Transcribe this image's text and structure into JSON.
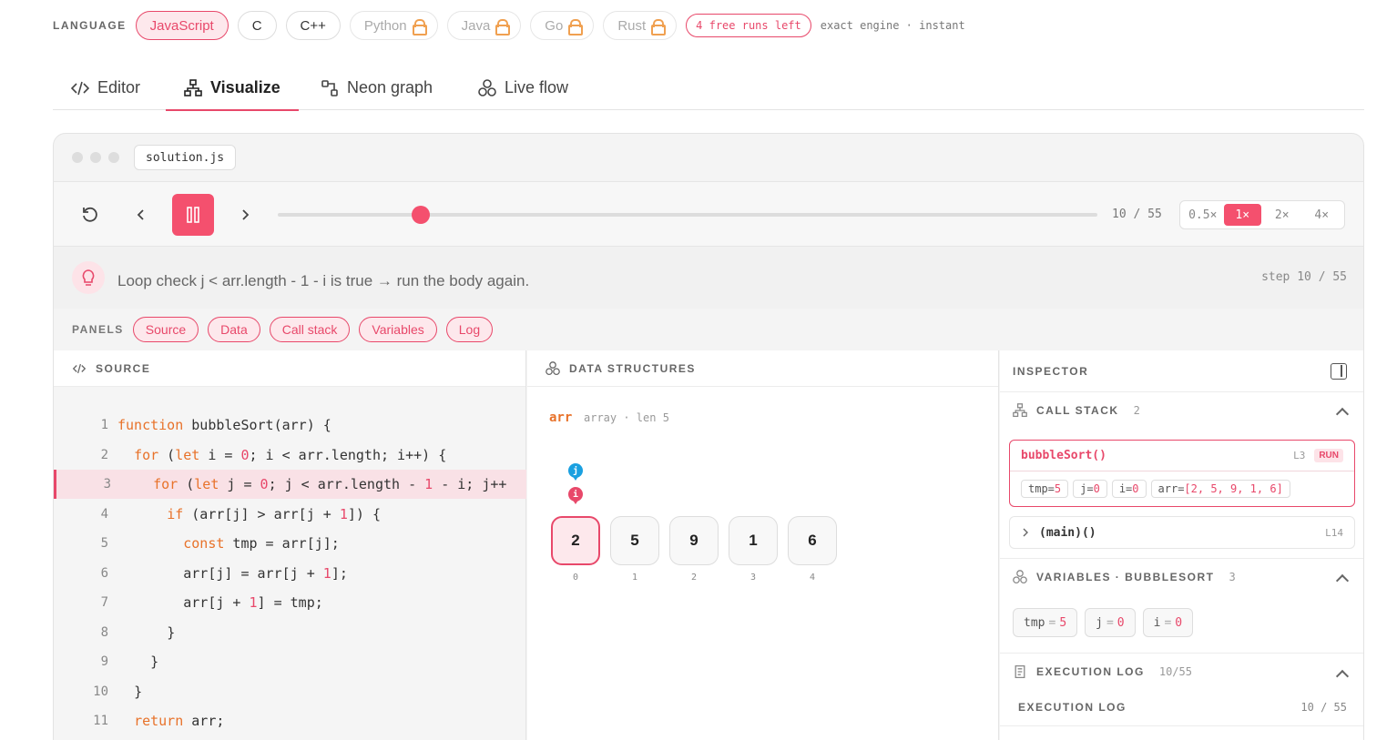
{
  "language_bar": {
    "label": "LANGUAGE",
    "languages": [
      {
        "name": "JavaScript",
        "state": "active"
      },
      {
        "name": "C",
        "state": "available"
      },
      {
        "name": "C++",
        "state": "available"
      },
      {
        "name": "Python",
        "state": "locked"
      },
      {
        "name": "Java",
        "state": "locked"
      },
      {
        "name": "Go",
        "state": "locked"
      },
      {
        "name": "Rust",
        "state": "locked"
      }
    ],
    "free_runs": "4 free runs left",
    "engine_note": "exact engine · instant"
  },
  "tabs": [
    {
      "label": "Editor",
      "icon": "code-icon"
    },
    {
      "label": "Visualize",
      "icon": "sitemap-icon",
      "active": true
    },
    {
      "label": "Neon graph",
      "icon": "graph-icon"
    },
    {
      "label": "Live flow",
      "icon": "hexagons-icon"
    }
  ],
  "window": {
    "filename": "solution.js"
  },
  "player": {
    "step_label": "10 / 55",
    "progress": 0.174,
    "speeds": [
      "0.5×",
      "1×",
      "2×",
      "4×"
    ],
    "active_speed": "1×"
  },
  "hint": {
    "text": "Loop check j < arr.length - 1 - i is true → run the body again.",
    "step": "step 10 / 55"
  },
  "panels": {
    "label": "PANELS",
    "items": [
      "Source",
      "Data",
      "Call stack",
      "Variables",
      "Log"
    ]
  },
  "source": {
    "title": "SOURCE",
    "highlighted_line": 3,
    "lines": [
      {
        "n": "1",
        "indent": "",
        "tokens": [
          {
            "t": "function",
            "c": "kw"
          },
          {
            "t": " bubbleSort(arr) {",
            "c": ""
          }
        ]
      },
      {
        "n": "2",
        "indent": "  ",
        "tokens": [
          {
            "t": "for",
            "c": "kw"
          },
          {
            "t": " (",
            "c": ""
          },
          {
            "t": "let",
            "c": "kw"
          },
          {
            "t": " i = ",
            "c": ""
          },
          {
            "t": "0",
            "c": "num"
          },
          {
            "t": "; i < arr.length; i++) {",
            "c": ""
          }
        ]
      },
      {
        "n": "3",
        "indent": "    ",
        "tokens": [
          {
            "t": "for",
            "c": "kw"
          },
          {
            "t": " (",
            "c": ""
          },
          {
            "t": "let",
            "c": "kw"
          },
          {
            "t": " j = ",
            "c": ""
          },
          {
            "t": "0",
            "c": "num"
          },
          {
            "t": "; j < arr.length - ",
            "c": ""
          },
          {
            "t": "1",
            "c": "num"
          },
          {
            "t": " - i; j++",
            "c": ""
          }
        ]
      },
      {
        "n": "4",
        "indent": "      ",
        "tokens": [
          {
            "t": "if",
            "c": "kw"
          },
          {
            "t": " (arr[j] > arr[j + ",
            "c": ""
          },
          {
            "t": "1",
            "c": "num"
          },
          {
            "t": "]) {",
            "c": ""
          }
        ]
      },
      {
        "n": "5",
        "indent": "        ",
        "tokens": [
          {
            "t": "const",
            "c": "kw"
          },
          {
            "t": " tmp = arr[j];",
            "c": ""
          }
        ]
      },
      {
        "n": "6",
        "indent": "        ",
        "tokens": [
          {
            "t": "arr[j] = arr[j + ",
            "c": ""
          },
          {
            "t": "1",
            "c": "num"
          },
          {
            "t": "];",
            "c": ""
          }
        ]
      },
      {
        "n": "7",
        "indent": "        ",
        "tokens": [
          {
            "t": "arr[j + ",
            "c": ""
          },
          {
            "t": "1",
            "c": "num"
          },
          {
            "t": "] = tmp;",
            "c": ""
          }
        ]
      },
      {
        "n": "8",
        "indent": "      ",
        "tokens": [
          {
            "t": "}",
            "c": ""
          }
        ]
      },
      {
        "n": "9",
        "indent": "    ",
        "tokens": [
          {
            "t": "}",
            "c": ""
          }
        ]
      },
      {
        "n": "10",
        "indent": "  ",
        "tokens": [
          {
            "t": "}",
            "c": ""
          }
        ]
      },
      {
        "n": "11",
        "indent": "  ",
        "tokens": [
          {
            "t": "return",
            "c": "kw"
          },
          {
            "t": " arr;",
            "c": ""
          }
        ]
      }
    ]
  },
  "data_structures": {
    "title": "DATA STRUCTURES",
    "array": {
      "name": "arr",
      "meta": "array · len 5",
      "values": [
        "2",
        "5",
        "9",
        "1",
        "6"
      ],
      "indices": [
        "0",
        "1",
        "2",
        "3",
        "4"
      ],
      "pointers": [
        {
          "label": "j",
          "index": 0,
          "color": "#1aa0e0"
        },
        {
          "label": "i",
          "index": 0,
          "color": "#e8486a"
        }
      ],
      "active_index": 0
    }
  },
  "inspector": {
    "title": "INSPECTOR",
    "call_stack": {
      "title": "CALL STACK",
      "count": "2",
      "frames": [
        {
          "name": "bubbleSort()",
          "line": "L3",
          "badge": "RUN",
          "chips": [
            {
              "k": "tmp=",
              "v": "5"
            },
            {
              "k": "j=",
              "v": "0"
            },
            {
              "k": "i=",
              "v": "0"
            },
            {
              "k": "arr=",
              "v": "[2, 5, 9, 1, 6]"
            }
          ]
        },
        {
          "name": "(main)()",
          "line": "L14"
        }
      ]
    },
    "variables": {
      "title": "VARIABLES · BUBBLESORT",
      "count": "3",
      "items": [
        {
          "k": "tmp",
          "v": "5"
        },
        {
          "k": "j",
          "v": "0"
        },
        {
          "k": "i",
          "v": "0"
        }
      ]
    },
    "log": {
      "title": "EXECUTION LOG",
      "count": "10/55",
      "subtitle": "EXECUTION LOG",
      "subcount": "10 / 55"
    }
  }
}
